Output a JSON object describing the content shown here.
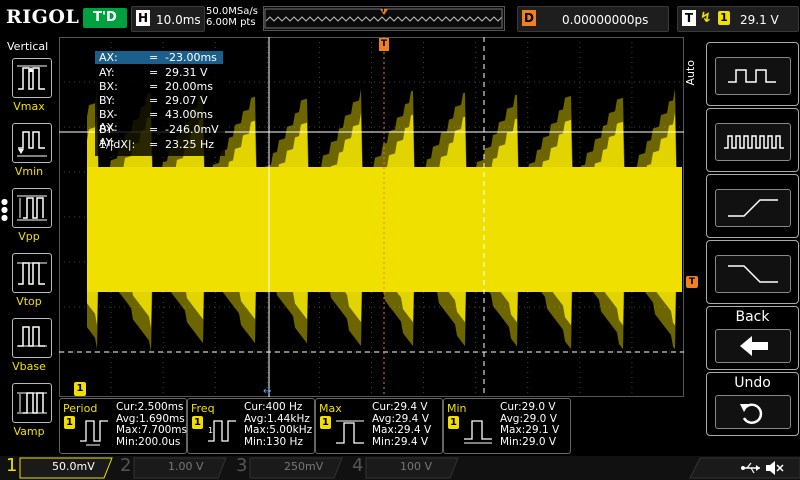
{
  "brand": "RIGOL",
  "trigger_status": "T'D",
  "horizontal": {
    "badge": "H",
    "timebase": "10.0ms"
  },
  "acquisition": {
    "sample_rate": "50.0MSa/s",
    "memory_depth": "6.00M pts"
  },
  "delay": {
    "badge": "D",
    "value": "0.00000000ps"
  },
  "trigger": {
    "badge": "T",
    "edge_icon": "rising-edge-icon",
    "source": "1",
    "level": "29.1 V"
  },
  "left_panel": {
    "title": "Vertical",
    "items": [
      {
        "label": "Vmax",
        "icon": "vmax-icon"
      },
      {
        "label": "Vmin",
        "icon": "vmin-icon"
      },
      {
        "label": "Vpp",
        "icon": "vpp-icon"
      },
      {
        "label": "Vtop",
        "icon": "vtop-icon"
      },
      {
        "label": "Vbase",
        "icon": "vbase-icon"
      },
      {
        "label": "Vamp",
        "icon": "vamp-icon"
      }
    ]
  },
  "cursor_readout": {
    "rows": [
      {
        "key": "AX:",
        "eq": "=",
        "value": "-23.00ms"
      },
      {
        "key": "AY:",
        "eq": "=",
        "value": "29.31 V"
      },
      {
        "key": "BX:",
        "eq": "=",
        "value": "20.00ms"
      },
      {
        "key": "BY:",
        "eq": "=",
        "value": "29.07 V"
      },
      {
        "key": "BX-AX:",
        "eq": "=",
        "value": "43.00ms"
      },
      {
        "key": "BY-AY:",
        "eq": "=",
        "value": "-246.0mV"
      },
      {
        "key": "1/|dX|:",
        "eq": "=",
        "value": "23.25 Hz"
      }
    ]
  },
  "right_panel": {
    "mode_label": "Auto",
    "buttons": [
      {
        "icon": "square-wave-icon"
      },
      {
        "icon": "pulse-train-icon"
      },
      {
        "icon": "rising-edge-measure-icon"
      },
      {
        "icon": "falling-edge-measure-icon"
      },
      {
        "label": "Back",
        "icon": "back-arrow-icon"
      },
      {
        "label": "Undo",
        "icon": "undo-icon"
      }
    ]
  },
  "markers": {
    "trigger_pos": "T",
    "trigger_level": "T",
    "ch1_ground": "1"
  },
  "measurements": [
    {
      "title": "Period",
      "channel": "1",
      "cur": "Cur:2.500ms",
      "avg": "Avg:1.690ms",
      "max": "Max:7.700ms",
      "min": "Min:200.0us"
    },
    {
      "title": "Freq",
      "channel": "1",
      "cur": "Cur:400 Hz",
      "avg": "Avg:1.44kHz",
      "max": "Max:5.00kHz",
      "min": "Min:130 Hz"
    },
    {
      "title": "Max",
      "channel": "1",
      "cur": "Cur:29.4 V",
      "avg": "Avg:29.4 V",
      "max": "Max:29.4 V",
      "min": "Min:29.4 V"
    },
    {
      "title": "Min",
      "channel": "1",
      "cur": "Cur:29.0 V",
      "avg": "Avg:29.0 V",
      "max": "Max:29.1 V",
      "min": "Min:29.0 V"
    }
  ],
  "channels": [
    {
      "num": "1",
      "scale": "50.0mV",
      "color": "#f0e000"
    },
    {
      "num": "2",
      "scale": "1.00 V",
      "color": "#00e0e0"
    },
    {
      "num": "3",
      "scale": "250mV",
      "color": "#e040e0"
    },
    {
      "num": "4",
      "scale": "100 V",
      "color": "#2070ff"
    }
  ],
  "status_icons": {
    "usb": "usb-icon",
    "sound": "speaker-muted-icon"
  },
  "colors": {
    "trace": "#f0e000",
    "trigger": "#f08020",
    "cursor_highlight": "#1c5f8c"
  }
}
